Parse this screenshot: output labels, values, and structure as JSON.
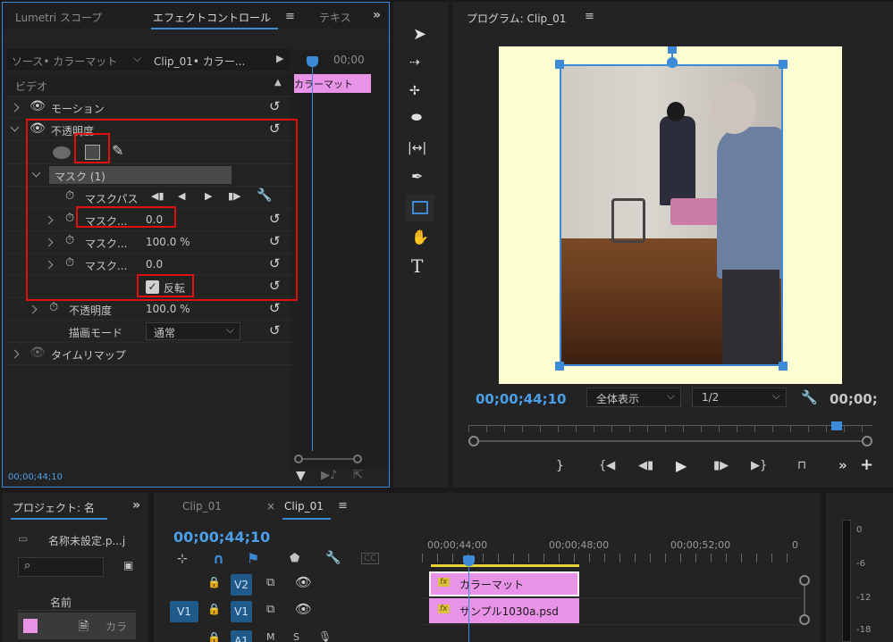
{
  "effect_panel": {
    "tabs": [
      "Lumetri スコープ",
      "エフェクトコントロール",
      "テキス"
    ],
    "source_label": "ソース• カラーマット",
    "clip_label": "Clip_01• カラー...",
    "timecode_small": "00;00",
    "clip_chip": "カラーマット",
    "section_video": "ビデオ",
    "rows": {
      "motion": "モーション",
      "opacity": "不透明度",
      "mask": "マスク (1)",
      "mask_path": "マスクパス",
      "mask_feather_label": "マスク...",
      "mask_feather_value": "0.0",
      "mask_opacity_label": "マスク...",
      "mask_opacity_value": "100.0 %",
      "mask_expansion_label": "マスク...",
      "mask_expansion_value": "0.0",
      "invert": "反転",
      "opacity2_label": "不透明度",
      "opacity2_value": "100.0 %",
      "blend_label": "描画モード",
      "blend_value": "通常",
      "time_remap": "タイムリマップ"
    },
    "footer_timecode": "00;00;44;10"
  },
  "program_monitor": {
    "title": "プログラム: Clip_01",
    "timecode": "00;00;44;10",
    "zoom": "全体表示",
    "quality": "1/2",
    "end_timecode": "00;00;"
  },
  "project_panel": {
    "title": "プロジェクト: 名",
    "item": "名称未設定.p...j",
    "column_name": "名前",
    "row_label": "カラ"
  },
  "timeline": {
    "tabs": [
      "Clip_01",
      "Clip_01"
    ],
    "timecode": "00;00;44;10",
    "ruler": [
      "00;00;44;00",
      "00;00;48;00",
      "00;00;52;00",
      "0"
    ],
    "tracks": {
      "v2": "V2",
      "v1": "V1",
      "v1_source": "V1",
      "a1": "A1"
    },
    "clip_v2": "カラーマット",
    "clip_v1": "サンプル1030a.psd",
    "fx_label": "fx"
  },
  "audio_meter": {
    "ticks": [
      "0",
      "-6",
      "-12",
      "-18"
    ]
  }
}
